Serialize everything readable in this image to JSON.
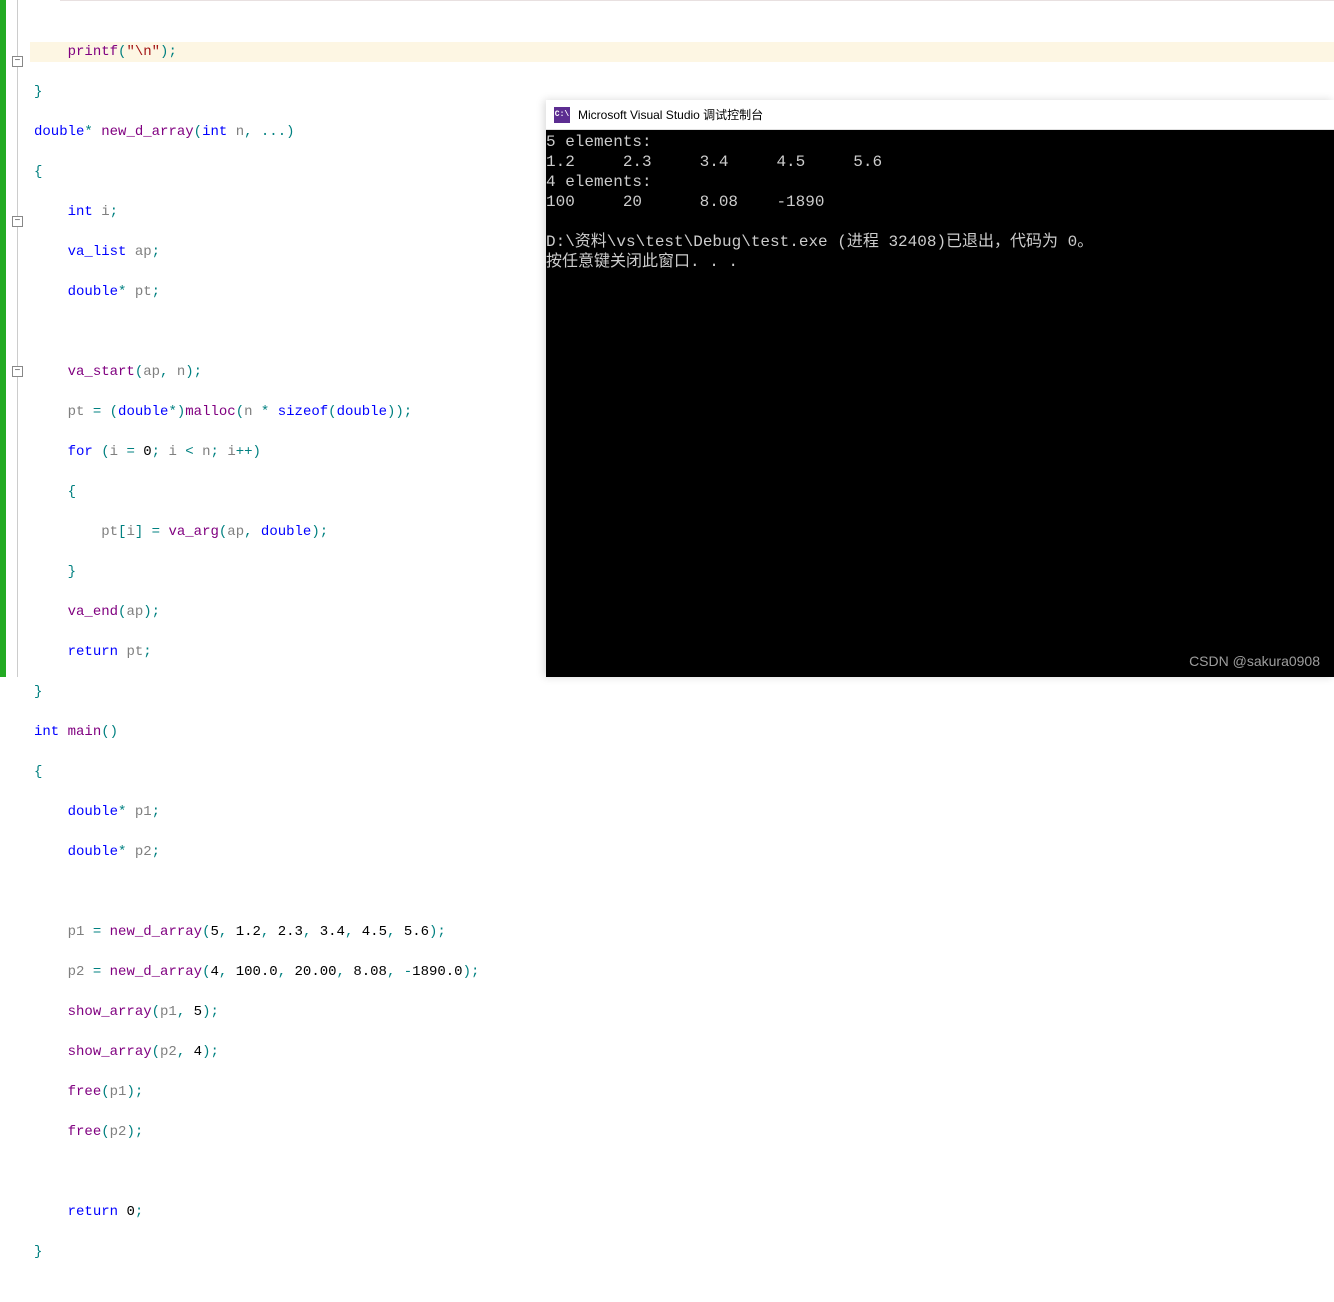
{
  "code": {
    "l1": "    printf(\"\\n\");",
    "l2": "}",
    "l3": "double* new_d_array(int n, ...)",
    "l4": "{",
    "l5": "    int i;",
    "l6": "    va_list ap;",
    "l7": "    double* pt;",
    "l8": "",
    "l9": "    va_start(ap, n);",
    "l10": "    pt = (double*)malloc(n * sizeof(double));",
    "l11": "    for (i = 0; i < n; i++)",
    "l12": "    {",
    "l13": "        pt[i] = va_arg(ap, double);",
    "l14": "    }",
    "l15": "    va_end(ap);",
    "l16": "    return pt;",
    "l17": "}",
    "l18": "int main()",
    "l19": "{",
    "l20": "    double* p1;",
    "l21": "    double* p2;",
    "l22": "",
    "l23": "    p1 = new_d_array(5, 1.2, 2.3, 3.4, 4.5, 5.6);",
    "l24": "    p2 = new_d_array(4, 100.0, 20.00, 8.08, -1890.0);",
    "l25": "    show_array(p1, 5);",
    "l26": "    show_array(p2, 4);",
    "l27": "    free(p1);",
    "l28": "    free(p2);",
    "l29": "",
    "l30": "    return 0;",
    "l31": "}"
  },
  "console": {
    "icon_text": "C:\\",
    "title": "Microsoft Visual Studio 调试控制台",
    "lines": [
      "5 elements:",
      "1.2     2.3     3.4     4.5     5.6",
      "4 elements:",
      "100     20      8.08    -1890",
      "",
      "D:\\资料\\vs\\test\\Debug\\test.exe (进程 32408)已退出，代码为 0。",
      "按任意键关闭此窗口. . ."
    ]
  },
  "watermark": "CSDN @sakura0908"
}
